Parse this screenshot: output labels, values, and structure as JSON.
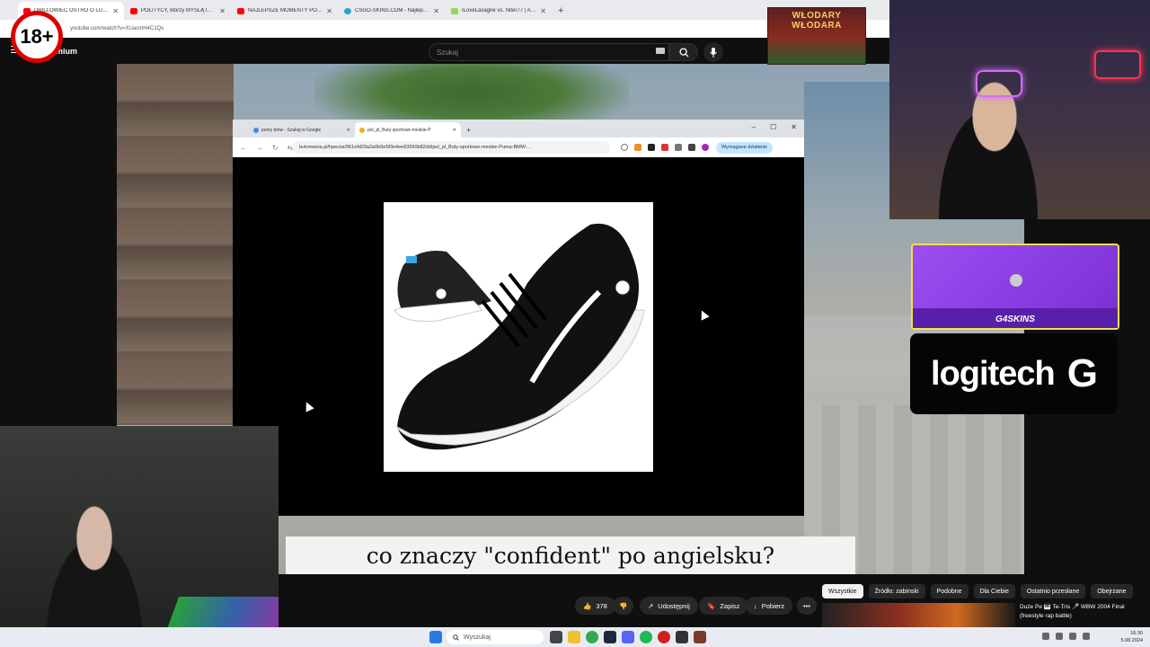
{
  "age_badge": "18+",
  "browser": {
    "tabs": [
      {
        "title": "DRILLOWIEC OSTRO O LUDZIACH",
        "color": "#ff0000",
        "active": true
      },
      {
        "title": "POLITYCY, którzy MYŚLĄ INACZEJ",
        "color": "#ff0000",
        "active": false
      },
      {
        "title": "NAJLEPSZE MOMENTY POLSKIEJ",
        "color": "#ff0000",
        "active": false
      },
      {
        "title": "CSGO-SKINS.COM - Najlepsze",
        "color": "#2aa0d8",
        "active": false
      },
      {
        "title": "ILoveLasagne vs. Niter77 | Anal",
        "color": "#9ad15a",
        "active": false
      }
    ],
    "new_tab": "+",
    "url": "youtube.com/watch?v=XUacmH4C1Qs"
  },
  "youtube": {
    "logo_text": "mium",
    "search_placeholder": "Szukaj"
  },
  "overlay_window": {
    "tabs": [
      {
        "title": "pumy bmw - Szukaj w Google",
        "color": "#4285f4",
        "active": false
      },
      {
        "title": "pol_pl_Buty-sportowe-meskie-P",
        "color": "#e8b020",
        "active": true
      }
    ],
    "new_tab": "+",
    "controls": [
      "–",
      "☐",
      "✕"
    ],
    "url": "butomania.pl/hpeciai/961efd20a2a0b6e5f3e4ee63690b82dd/pol_pl_Buty-sportowe-meskie-Puma-BMW-...",
    "action_button": "Wymagane działanie",
    "nav": [
      "←",
      "→",
      "↻",
      "⇆"
    ]
  },
  "subtitle": "co znaczy \"confident\" po angielsku?",
  "wlodary_banner": "WŁODARY WŁODARA",
  "g4skins": {
    "label": "G4SKINS"
  },
  "logitech": {
    "brand": "logitech",
    "mark": "G"
  },
  "actions": {
    "likes": "378",
    "share": "Udostępnij",
    "save": "Zapisz",
    "download": "Pobierz",
    "more": "•••"
  },
  "chips": [
    {
      "label": "Wszystkie",
      "active": true
    },
    {
      "label": "Źródło: zabinski",
      "active": false
    },
    {
      "label": "Podobne",
      "active": false
    },
    {
      "label": "Dla Ciebie",
      "active": false
    },
    {
      "label": "Ostatnio przesłane",
      "active": false
    },
    {
      "label": "Obejrzane",
      "active": false
    }
  ],
  "recommendation": {
    "title_line1": "Duże Pe 🎹 Te-Tris 🎤 WBW 2004 Final",
    "title_line2": "(freestyle rap battle)"
  },
  "taskbar": {
    "search_placeholder": "Wyszukaj",
    "time": "16:30",
    "date": "5.08.2024",
    "icons": [
      {
        "name": "windows-start",
        "color": "#2a7ae2"
      },
      {
        "name": "file-explorer",
        "color": "#f0c030"
      },
      {
        "name": "chrome",
        "color": "#34a853"
      },
      {
        "name": "steam",
        "color": "#1b2838"
      },
      {
        "name": "discord",
        "color": "#5865f2"
      },
      {
        "name": "spotify",
        "color": "#1db954"
      },
      {
        "name": "obs",
        "color": "#d02020"
      },
      {
        "name": "app-8",
        "color": "#333333"
      },
      {
        "name": "app-9",
        "color": "#7a3a2a"
      }
    ]
  }
}
